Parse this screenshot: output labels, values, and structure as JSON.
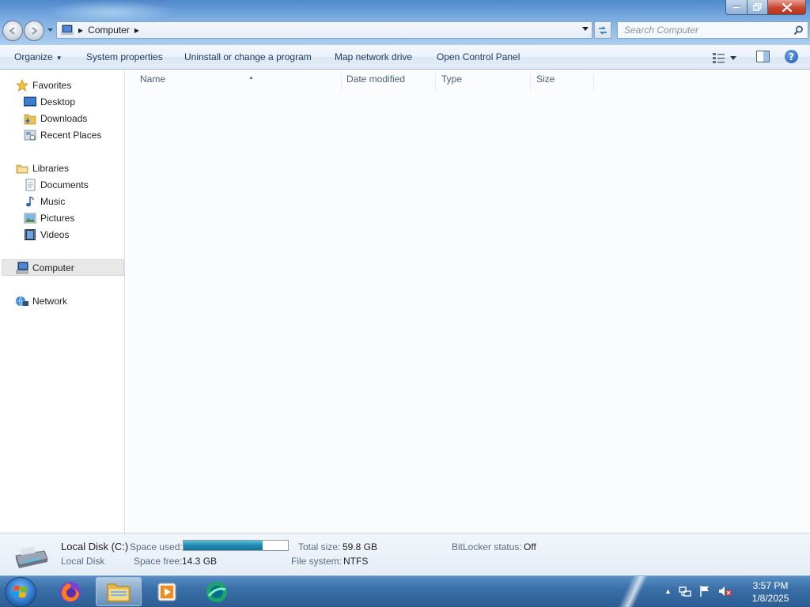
{
  "window": {
    "address_crumb": "Computer",
    "search_placeholder": "Search Computer"
  },
  "command_bar": {
    "organize_label": "Organize",
    "system_properties_label": "System properties",
    "uninstall_label": "Uninstall or change a program",
    "map_drive_label": "Map network drive",
    "control_panel_label": "Open Control Panel",
    "help_label": "?"
  },
  "nav": {
    "favorites": "Favorites",
    "desktop": "Desktop",
    "downloads": "Downloads",
    "recent_places": "Recent Places",
    "libraries": "Libraries",
    "documents": "Documents",
    "music": "Music",
    "pictures": "Pictures",
    "videos": "Videos",
    "computer": "Computer",
    "network": "Network"
  },
  "columns": {
    "name": "Name",
    "date_modified": "Date modified",
    "type": "Type",
    "size": "Size"
  },
  "details": {
    "drive_title": "Local Disk (C:)",
    "drive_kind": "Local Disk",
    "space_used_label": "Space used:",
    "space_used_fraction": 0.76,
    "space_free_label": "Space free:",
    "space_free_value": "14.3 GB",
    "total_size_label": "Total size:",
    "total_size_value": "59.8 GB",
    "file_system_label": "File system:",
    "file_system_value": "NTFS",
    "bitlocker_label": "BitLocker status:",
    "bitlocker_value": "Off"
  },
  "taskbar": {
    "apps": [
      "firefox-icon",
      "windows-explorer-icon",
      "media-player-icon",
      "app-icon"
    ],
    "time": "3:57 PM",
    "date": "1/8/2025"
  }
}
